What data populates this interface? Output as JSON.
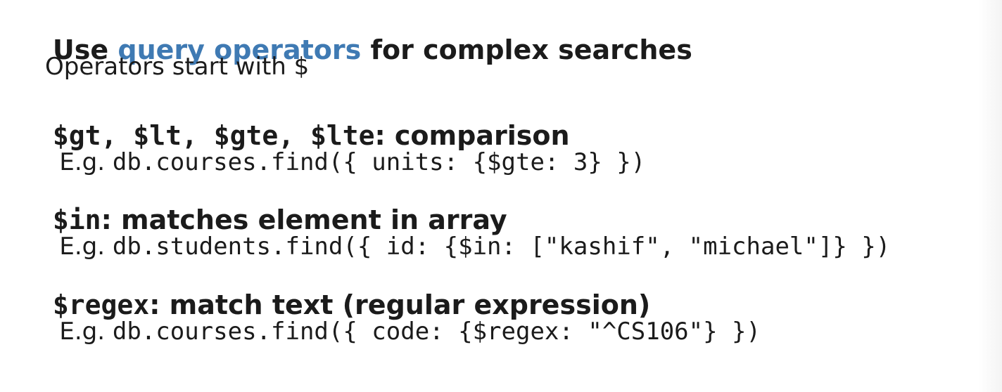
{
  "heading": {
    "prefix": "Use ",
    "link": "query operators",
    "suffix": " for complex searches"
  },
  "intro": "Operators start with $",
  "items": [
    {
      "term": "$gt, $lt, $gte, $lte",
      "desc": ": comparison",
      "example_prefix": "E.g. ",
      "example_code": "db.courses.find({ units: {$gte: 3} })"
    },
    {
      "term": "$in",
      "desc": ": matches element in array",
      "example_prefix": "E.g. ",
      "example_code": "db.students.find({ id: {$in: [\"kashif\", \"michael\"]} })"
    },
    {
      "term": "$regex",
      "desc": ": match text (regular expression)",
      "example_prefix": "E.g. ",
      "example_code": "db.courses.find({ code: {$regex: \"^CS106\"} })"
    }
  ],
  "colors": {
    "text": "#1b1b1b",
    "link": "#3f7ab3",
    "background": "#ffffff"
  }
}
